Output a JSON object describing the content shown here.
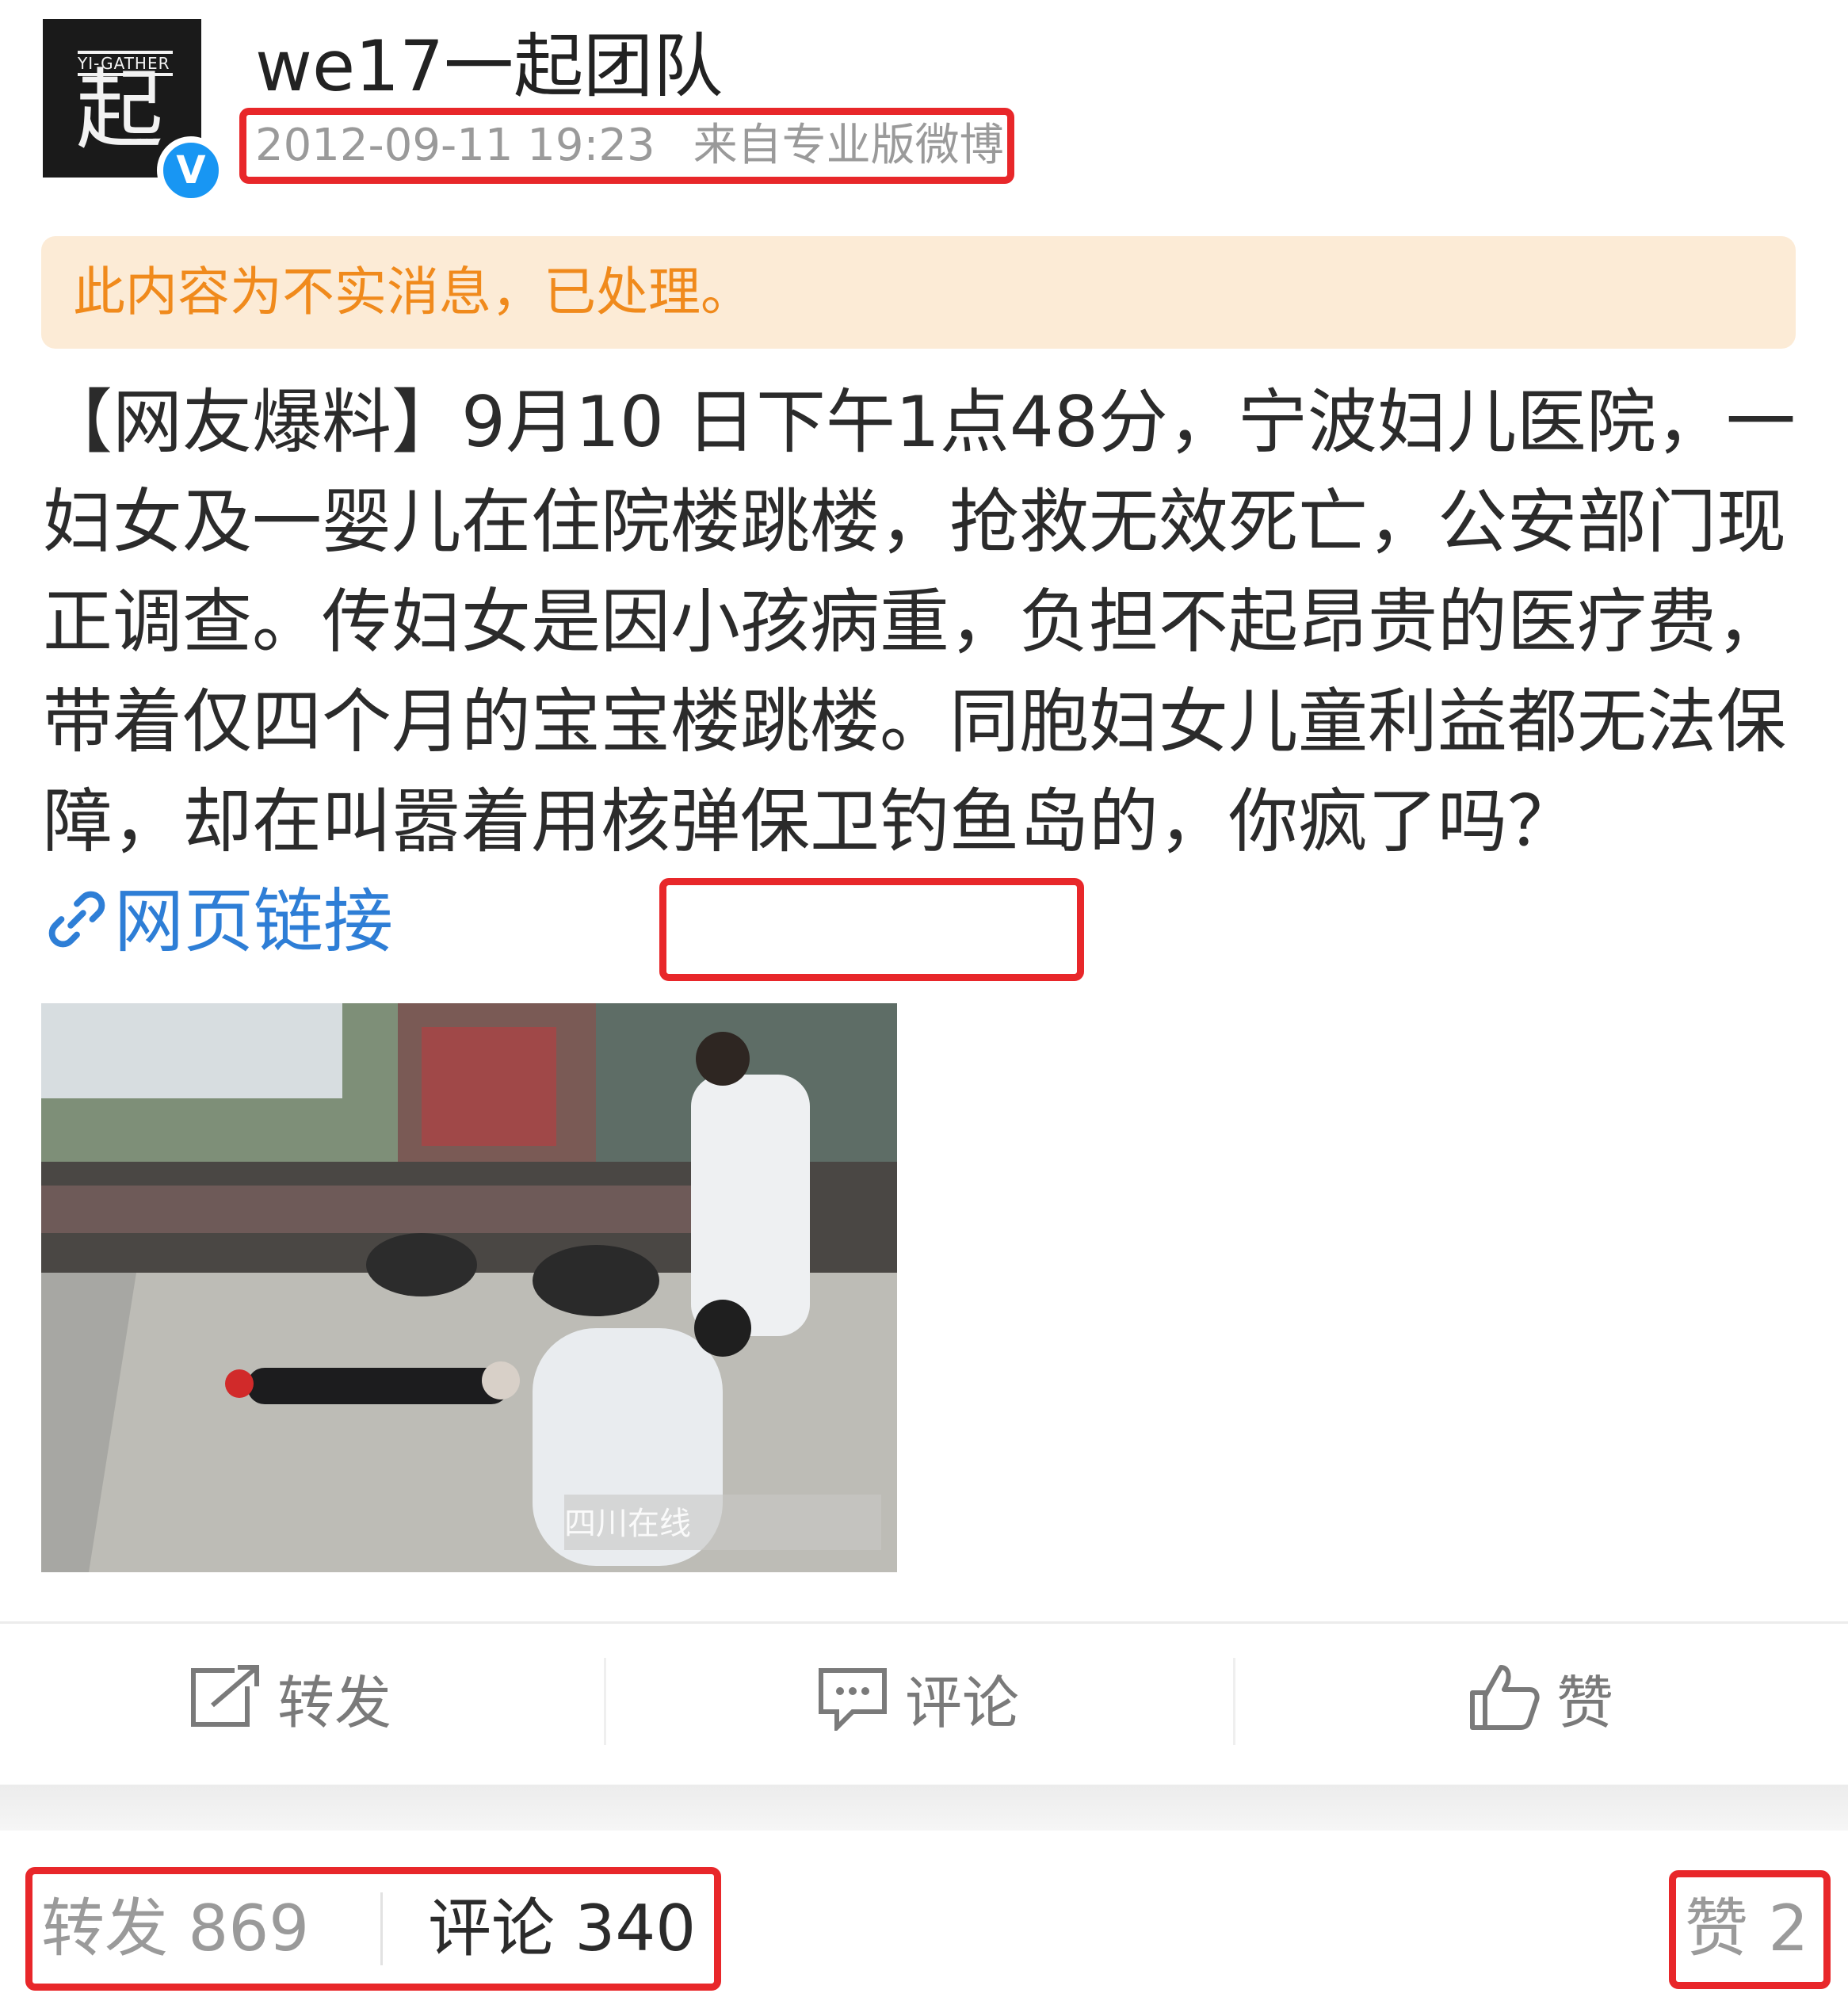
{
  "user": {
    "name": "we17一起团队",
    "avatar_small_text": "YI-GATHER",
    "avatar_big_text": "起",
    "verified_mark": "V"
  },
  "post": {
    "time": "2012-09-11 19:23",
    "source": "来自专业版微博",
    "notice": "此内容为不实消息，已处理。",
    "text": "【网友爆料】9月10 日下午1点48分，宁波妇儿医院，一妇女及一婴儿在住院楼跳楼，抢救无效死亡，公安部门现正调查。传妇女是因小孩病重，负担不起昂贵的医疗费，带着仅四个月的宝宝楼跳楼。同胞妇女儿童利益都无法保障，却在叫嚣着用核弹保卫钓鱼岛的，你疯了吗？",
    "link_label": "网页链接",
    "photo_watermark": "四川在线"
  },
  "actions": {
    "repost": "转发",
    "comment": "评论",
    "like": "赞"
  },
  "stats": {
    "repost": "转发 869",
    "comment": "评论 340",
    "like": "赞 2"
  },
  "colors": {
    "highlight": "#e8272a",
    "link": "#2e7ed6",
    "notice_text": "#f08a1c",
    "notice_bg": "#fcebd6",
    "verified": "#1896f3"
  }
}
